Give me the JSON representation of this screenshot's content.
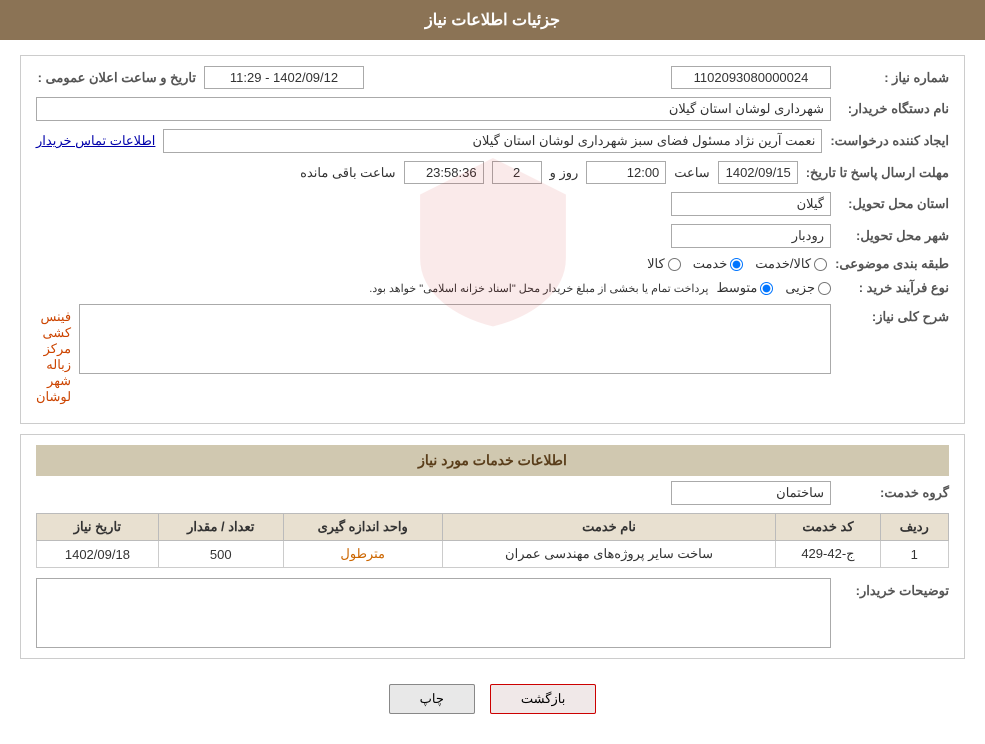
{
  "header": {
    "title": "جزئیات اطلاعات نیاز"
  },
  "form": {
    "need_number_label": "شماره نیاز :",
    "need_number_value": "1102093080000024",
    "buyer_org_label": "نام دستگاه خریدار:",
    "buyer_org_value": "شهرداری لوشان استان گیلان",
    "creator_label": "ایجاد کننده درخواست:",
    "creator_value": "نعمت آرین نژاد مسئول فضای سبز شهرداری لوشان استان گیلان",
    "contact_link": "اطلاعات تماس خریدار",
    "deadline_label": "مهلت ارسال پاسخ تا تاریخ:",
    "deadline_date": "1402/09/15",
    "deadline_time_label": "ساعت",
    "deadline_time": "12:00",
    "deadline_days_label": "روز و",
    "deadline_days": "2",
    "deadline_remaining_label": "ساعت باقی مانده",
    "deadline_remaining": "23:58:36",
    "announce_label": "تاریخ و ساعت اعلان عمومی :",
    "announce_value": "1402/09/12 - 11:29",
    "province_label": "استان محل تحویل:",
    "province_value": "گیلان",
    "city_label": "شهر محل تحویل:",
    "city_value": "رودبار",
    "category_label": "طبقه بندی موضوعی:",
    "category_options": [
      {
        "label": "کالا",
        "value": "kala"
      },
      {
        "label": "خدمت",
        "value": "khedmat"
      },
      {
        "label": "کالا/خدمت",
        "value": "kala_khedmat"
      }
    ],
    "category_selected": "khedmat",
    "purchase_type_label": "نوع فرآیند خرید :",
    "purchase_type_options": [
      {
        "label": "جزیی",
        "value": "jozii"
      },
      {
        "label": "متوسط",
        "value": "mota"
      },
      {
        "label": "notice",
        "value": "note"
      }
    ],
    "purchase_type_notice": "پرداخت تمام یا بخشی از مبلغ خریدار محل \"اسناد خزانه اسلامی\" خواهد بود.",
    "description_label": "شرح کلی نیاز:",
    "description_value": "فینس کشی مرکز زباله شهر لوشان",
    "services_header": "اطلاعات خدمات مورد نیاز",
    "group_label": "گروه خدمت:",
    "group_value": "ساختمان",
    "table": {
      "columns": [
        "ردیف",
        "کد خدمت",
        "نام خدمت",
        "واحد اندازه گیری",
        "تعداد / مقدار",
        "تاریخ نیاز"
      ],
      "rows": [
        {
          "row": "1",
          "code": "ج-42-429",
          "name": "ساخت سایر پروژه‌های مهندسی عمران",
          "unit": "مترطول",
          "qty": "500",
          "date": "1402/09/18"
        }
      ]
    },
    "buyer_notes_label": "توضیحات خریدار:",
    "buyer_notes_value": ""
  },
  "buttons": {
    "print": "چاپ",
    "back": "بازگشت"
  }
}
